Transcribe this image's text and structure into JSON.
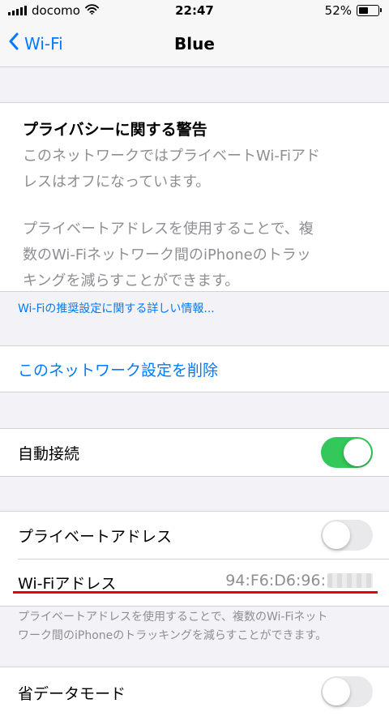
{
  "status_bar": {
    "carrier": "docomo",
    "time": "22:47",
    "battery": "52%"
  },
  "nav": {
    "back_label": "Wi-Fi",
    "title": "Blue"
  },
  "privacy_warning": {
    "title": "プライバシーに関する警告",
    "paragraph1_line1": "このネットワークではプライベートWi-Fiアド",
    "paragraph1_line2": "レスはオフになっています。",
    "paragraph2_line1": "プライベートアドレスを使用することで、複",
    "paragraph2_line2": "数のWi-Fiネットワーク間のiPhoneのトラッ",
    "paragraph2_line3": "キングを減らすことができます。"
  },
  "info_link": "Wi-Fiの推奨設定に関する詳しい情報...",
  "delete_network": "このネットワーク設定を削除",
  "auto_join": {
    "label": "自動接続",
    "on": true
  },
  "private_address": {
    "label": "プライベートアドレス",
    "on": false
  },
  "wifi_address": {
    "label": "Wi-Fiアドレス",
    "value": "94:F6:D6:96:"
  },
  "footer_note": {
    "line1": "プライベートアドレスを使用することで、複数のWi-Fiネット",
    "line2": "ワーク間のiPhoneのトラッキングを減らすことができます。"
  },
  "low_data_mode": {
    "label": "省データモード",
    "on": false
  },
  "colors": {
    "accent": "#007aff",
    "toggle_on": "#34c759",
    "annotation_red": "#e60012"
  },
  "icons": [
    "signal-icon",
    "wifi-icon",
    "battery-icon",
    "chevron-left-icon"
  ]
}
